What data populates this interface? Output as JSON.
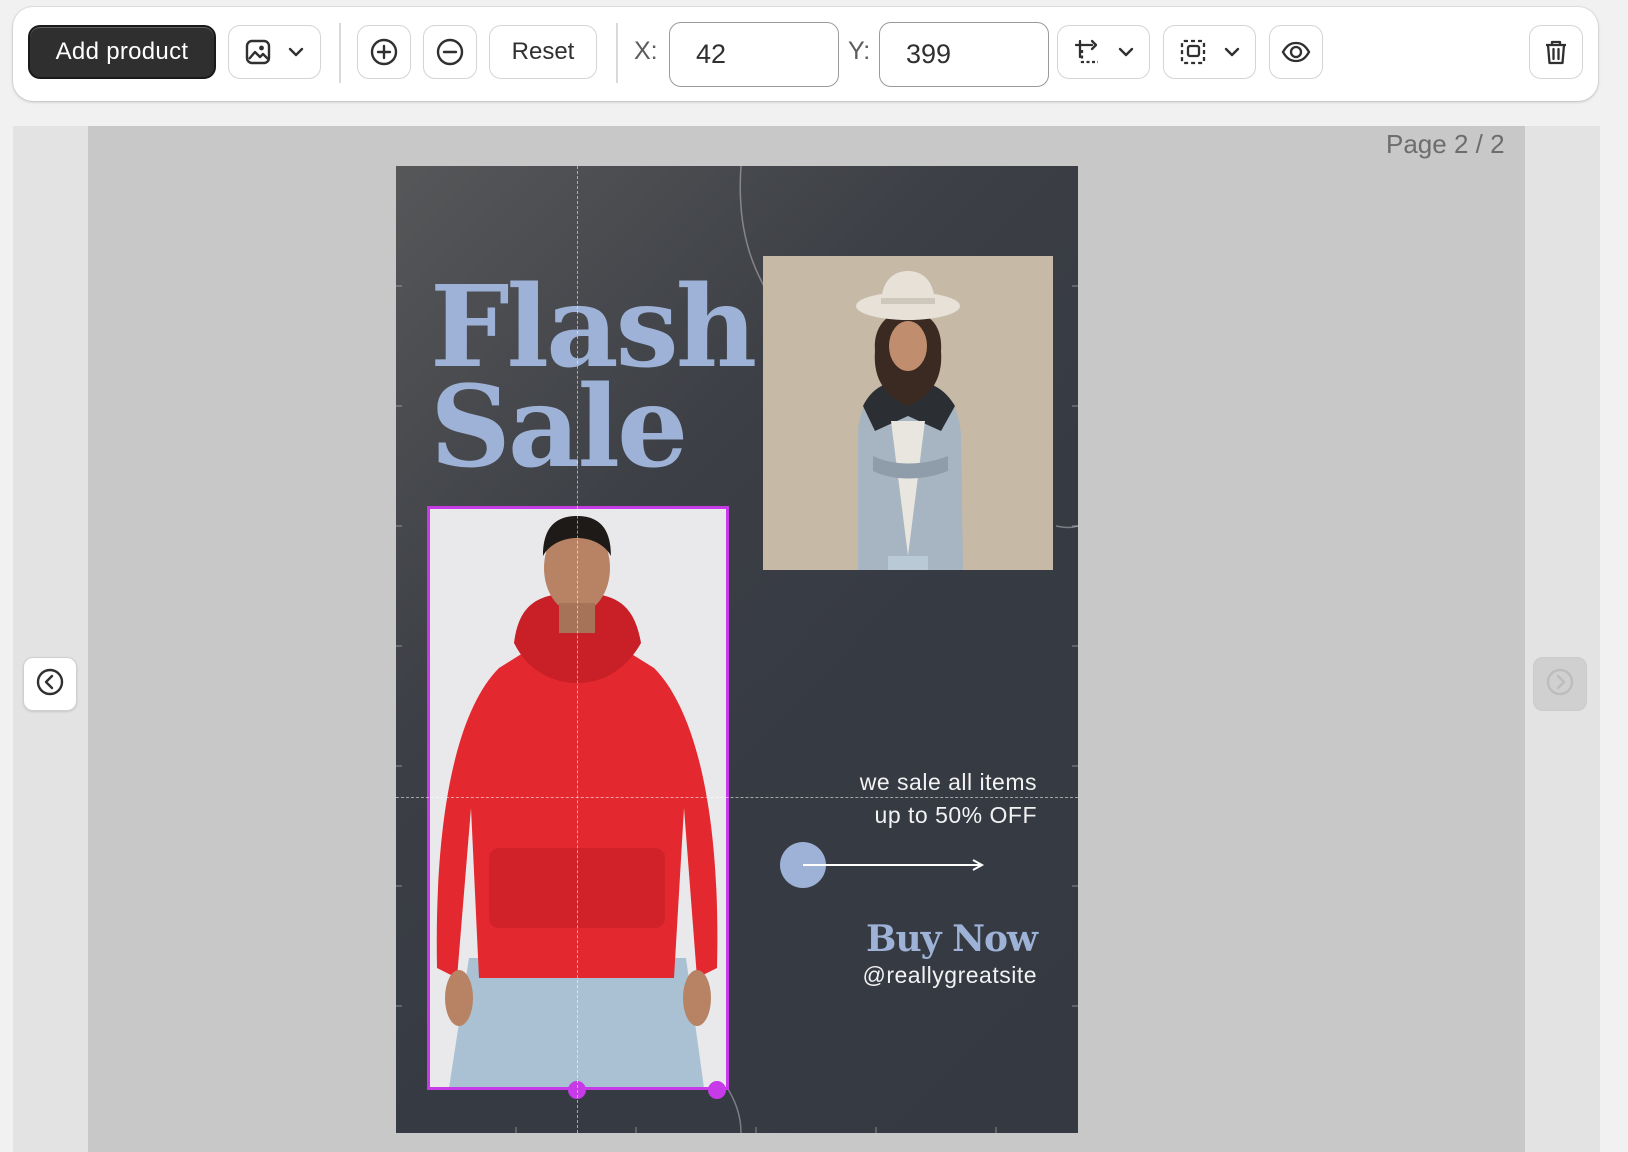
{
  "toolbar": {
    "add_product_label": "Add product",
    "reset_label": "Reset",
    "x_label": "X:",
    "x_value": "42",
    "y_label": "Y:",
    "y_value": "399",
    "icons": [
      "image-icon",
      "chevron-down-icon",
      "zoom-in-icon",
      "zoom-out-icon",
      "transform-icon",
      "frame-icon",
      "eye-icon",
      "trash-icon"
    ]
  },
  "canvas": {
    "page_indicator": "Page 2 / 2",
    "nav": {
      "prev_icon": "chevron-left-circle-icon",
      "next_icon": "chevron-right-circle-icon"
    }
  },
  "poster": {
    "title": "Flash\nSale",
    "tagline_line1": "we sale all items",
    "tagline_line2": "up to 50% OFF",
    "cta": "Buy Now",
    "handle": "@reallygreatsite",
    "colors": {
      "background": "#373b44",
      "accent": "#9db2d6",
      "selection": "#c63ae8"
    }
  }
}
